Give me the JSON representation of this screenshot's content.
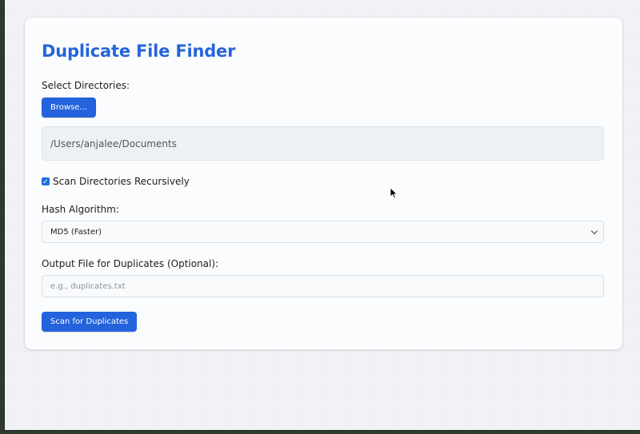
{
  "app": {
    "title": "Duplicate File Finder"
  },
  "directories": {
    "label": "Select Directories:",
    "browse_label": "Browse...",
    "selected_path": "/Users/anjalee/Documents"
  },
  "recursive": {
    "label": "Scan Directories Recursively",
    "checked": true
  },
  "hash": {
    "label": "Hash Algorithm:",
    "selected": "MD5 (Faster)"
  },
  "output": {
    "label": "Output File for Duplicates (Optional):",
    "placeholder": "e.g., duplicates.txt",
    "value": ""
  },
  "actions": {
    "scan_label": "Scan for Duplicates"
  },
  "colors": {
    "accent": "#2363dc",
    "title": "#2565d9"
  }
}
